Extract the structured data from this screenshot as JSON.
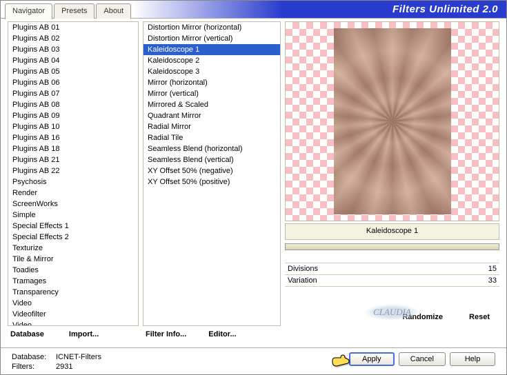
{
  "app_title": "Filters Unlimited 2.0",
  "tabs": {
    "navigator": "Navigator",
    "presets": "Presets",
    "about": "About"
  },
  "categories": [
    "Plugins AB 01",
    "Plugins AB 02",
    "Plugins AB 03",
    "Plugins AB 04",
    "Plugins AB 05",
    "Plugins AB 06",
    "Plugins AB 07",
    "Plugins AB 08",
    "Plugins AB 09",
    "Plugins AB 10",
    "Plugins AB 16",
    "Plugins AB 18",
    "Plugins AB 21",
    "Plugins AB 22",
    "Psychosis",
    "Render",
    "ScreenWorks",
    "Simple",
    "Special Effects 1",
    "Special Effects 2",
    "Texturize",
    "Tile & Mirror",
    "Toadies",
    "Tramages",
    "Transparency",
    "Video",
    "Videofilter",
    "Video"
  ],
  "selected_category_index": 21,
  "filters": [
    "Distortion Mirror (horizontal)",
    "Distortion Mirror (vertical)",
    "Kaleidoscope 1",
    "Kaleidoscope 2",
    "Kaleidoscope 3",
    "Mirror (horizontal)",
    "Mirror (vertical)",
    "Mirrored & Scaled",
    "Quadrant Mirror",
    "Radial Mirror",
    "Radial Tile",
    "Seamless Blend (horizontal)",
    "Seamless Blend (vertical)",
    "XY Offset 50% (negative)",
    "XY Offset 50% (positive)"
  ],
  "selected_filter_index": 2,
  "bottom_links": {
    "database": "Database",
    "import": "Import...",
    "filter_info": "Filter Info...",
    "editor": "Editor..."
  },
  "preview": {
    "title": "Kaleidoscope 1"
  },
  "params": [
    {
      "name": "Divisions",
      "value": "15"
    },
    {
      "name": "Variation",
      "value": "33"
    }
  ],
  "right_links": {
    "randomize": "Randomize",
    "reset": "Reset"
  },
  "dialog_buttons": {
    "apply": "Apply",
    "cancel": "Cancel",
    "help": "Help"
  },
  "status": {
    "database_label": "Database:",
    "database_value": "ICNET-Filters",
    "filters_label": "Filters:",
    "filters_value": "2931"
  },
  "watermark": "CLAUDIA"
}
